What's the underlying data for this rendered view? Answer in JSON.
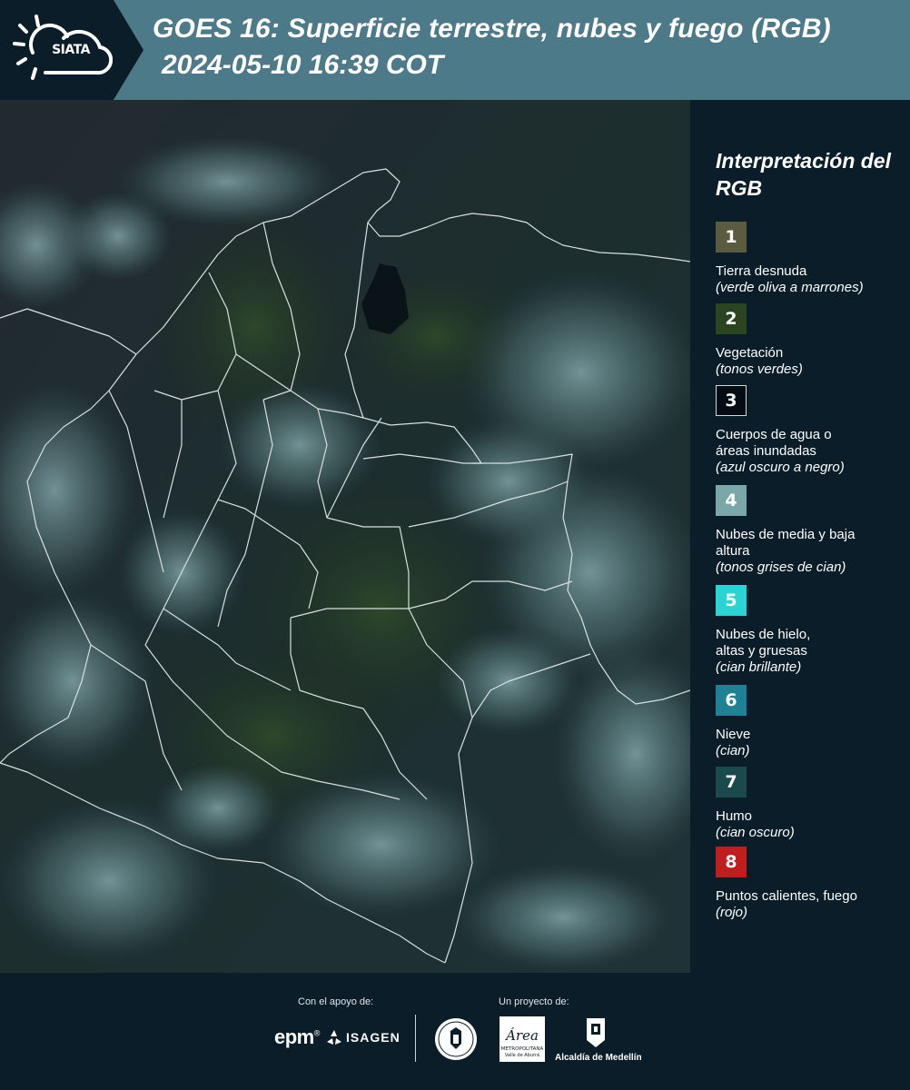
{
  "header": {
    "logo_text": "SIATA",
    "title": "GOES 16: Superficie terrestre, nubes y fuego (RGB)",
    "subtitle": "2024-05-10 16:39 COT"
  },
  "map": {
    "icon": "satellite-map-image"
  },
  "legend": {
    "title": "Interpretación del RGB",
    "items": [
      {
        "num": "1",
        "label": "Tierra desnuda",
        "desc": "(verde oliva a marrones)",
        "color": "#5b5b40"
      },
      {
        "num": "2",
        "label": "Vegetación",
        "desc": "(tonos verdes)",
        "color": "#2c4420"
      },
      {
        "num": "3",
        "label": "Cuerpos de agua o áreas inundadas",
        "desc": "(azul oscuro a negro)",
        "color": "#050d14"
      },
      {
        "num": "4",
        "label": "Nubes de media y baja altura",
        "desc": "(tonos grises de cian)",
        "color": "#7aa8a8"
      },
      {
        "num": "5",
        "label": "Nubes de hielo, altas y gruesas",
        "desc": "(cian brillante)",
        "color": "#2ad4d4"
      },
      {
        "num": "6",
        "label": "Nieve",
        "desc": "(cian)",
        "color": "#1d8294"
      },
      {
        "num": "7",
        "label": "Humo",
        "desc": "(cian oscuro)",
        "color": "#1b4a4c"
      },
      {
        "num": "8",
        "label": "Puntos calientes, fuego",
        "desc": "(rojo)",
        "color": "#c21d1d"
      }
    ]
  },
  "footer": {
    "support_label": "Con el apoyo de:",
    "project_label": "Un proyecto de:",
    "epm": "epm",
    "epm_mark": "®",
    "isagen": "ISAGEN",
    "amva_line1": "Área",
    "amva_line2": "METROPOLITANA",
    "amva_line3": "Valle de Aburrá",
    "medellin": "Alcaldía de Medellín"
  }
}
